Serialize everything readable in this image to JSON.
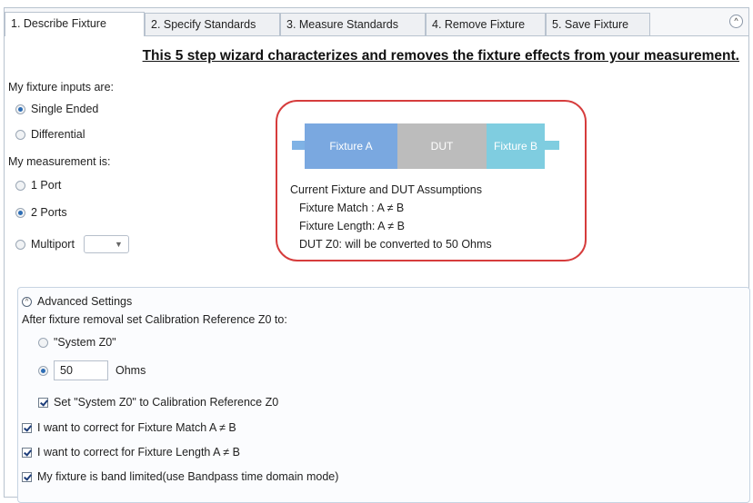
{
  "tabs": [
    {
      "label": "1. Describe Fixture",
      "active": true
    },
    {
      "label": "2. Specify Standards",
      "active": false
    },
    {
      "label": "3. Measure Standards",
      "active": false
    },
    {
      "label": "4. Remove Fixture",
      "active": false
    },
    {
      "label": "5. Save Fixture",
      "active": false
    }
  ],
  "collapse_icon": "chevron-up-icon",
  "title": "This 5 step wizard characterizes and removes the fixture effects from your measurement.",
  "fixture_inputs": {
    "label": "My fixture inputs are:",
    "options": [
      {
        "label": "Single Ended",
        "selected": true
      },
      {
        "label": "Differential",
        "selected": false
      }
    ]
  },
  "measurement": {
    "label": "My measurement is:",
    "options": [
      {
        "label": "1 Port",
        "selected": false
      },
      {
        "label": "2 Ports",
        "selected": true
      },
      {
        "label": "Multiport",
        "selected": false
      }
    ],
    "multiport_value": ""
  },
  "diagram": {
    "fixture_a": "Fixture A",
    "dut": "DUT",
    "fixture_b": "Fixture B",
    "colors": {
      "fixture_a": "#7aa8e0",
      "dut": "#bcbcbc",
      "fixture_b": "#7fcde0",
      "border": "#d63c3c"
    }
  },
  "assumptions": {
    "heading": "Current Fixture and DUT Assumptions",
    "match": "Fixture Match : A ≠ B",
    "length": "Fixture Length: A ≠ B",
    "z0": "DUT Z0: will be converted to 50 Ohms"
  },
  "advanced": {
    "title": "Advanced Settings",
    "ref_label": "After fixture removal set Calibration Reference Z0 to:",
    "system_z0": "\"System Z0\"",
    "z0_value": "50",
    "z0_unit": "Ohms",
    "set_system_z0": "Set \"System Z0\" to Calibration Reference Z0",
    "correct_match": "I want to correct for Fixture Match A ≠ B",
    "correct_length": "I want to correct for Fixture Length A ≠ B",
    "band_limited": "My fixture is band limited(use Bandpass time domain mode)"
  }
}
